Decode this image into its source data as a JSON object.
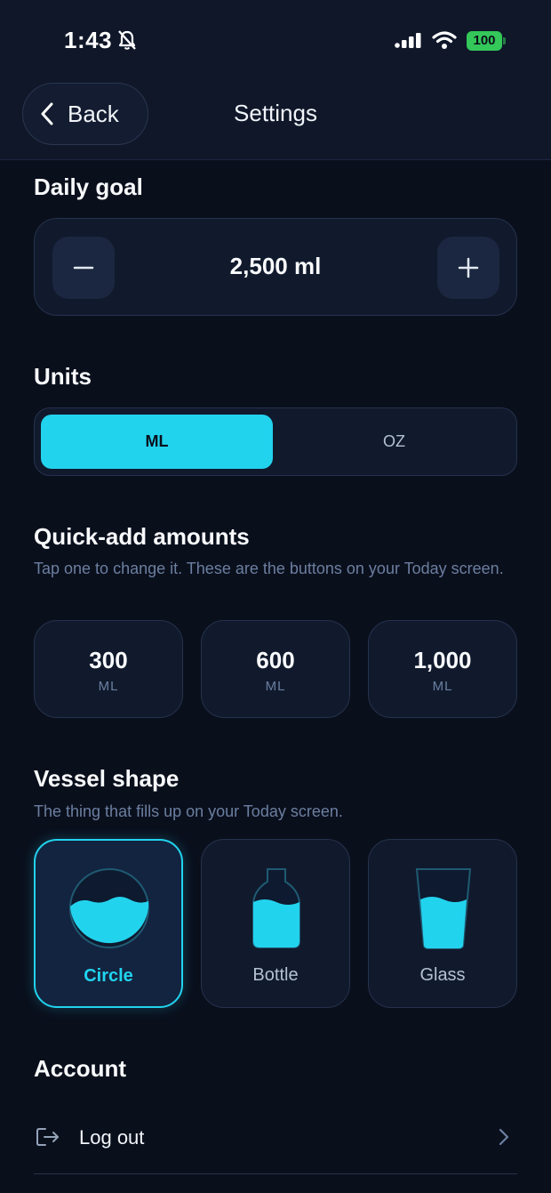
{
  "status_bar": {
    "time": "1:43",
    "battery": "100"
  },
  "nav": {
    "back_label": "Back",
    "title": "Settings"
  },
  "daily_goal": {
    "title": "Daily goal",
    "value": "2,500 ml"
  },
  "units": {
    "title": "Units",
    "options": [
      "ML",
      "OZ"
    ],
    "selected": "ML"
  },
  "quick_add": {
    "title": "Quick-add amounts",
    "subtitle": "Tap one to change it. These are the buttons on your Today screen.",
    "amounts": [
      {
        "value": "300",
        "unit": "ML"
      },
      {
        "value": "600",
        "unit": "ML"
      },
      {
        "value": "1,000",
        "unit": "ML"
      }
    ]
  },
  "vessel": {
    "title": "Vessel shape",
    "subtitle": "The thing that fills up on your Today screen.",
    "options": [
      "Circle",
      "Bottle",
      "Glass"
    ],
    "selected": "Circle"
  },
  "account": {
    "title": "Account",
    "logout_label": "Log out"
  },
  "colors": {
    "accent": "#22d3ee",
    "background": "#0a0f1c",
    "card": "#111a2d",
    "battery": "#34c759"
  }
}
